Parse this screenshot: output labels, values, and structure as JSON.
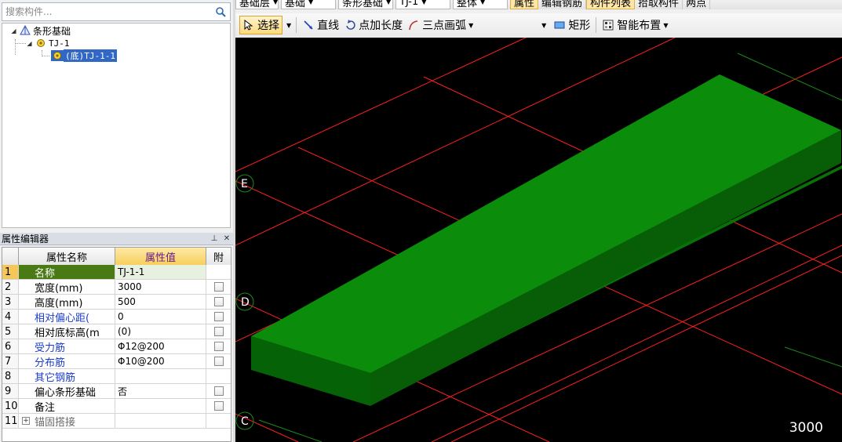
{
  "search": {
    "placeholder": "搜索构件..."
  },
  "tree": {
    "root": "条形基础",
    "group": "TJ-1",
    "leaf": "(底)TJ-1-1"
  },
  "property_editor": {
    "title": "属性编辑器",
    "headers": {
      "num": "",
      "name": "属性名称",
      "value": "属性值",
      "attach": "附"
    },
    "rows": [
      {
        "num": "1",
        "name": "名称",
        "value": "TJ-1-1",
        "checkbox": false,
        "selected": true
      },
      {
        "num": "2",
        "name": "宽度(mm)",
        "value": "3000",
        "checkbox": true
      },
      {
        "num": "3",
        "name": "高度(mm)",
        "value": "500",
        "checkbox": true
      },
      {
        "num": "4",
        "name": "相对偏心距(",
        "value": "0",
        "checkbox": true,
        "blue": true
      },
      {
        "num": "5",
        "name": "相对底标高(m",
        "value": "(0)",
        "checkbox": true
      },
      {
        "num": "6",
        "name": "受力筋",
        "value": "Φ12@200",
        "checkbox": true,
        "blue": true
      },
      {
        "num": "7",
        "name": "分布筋",
        "value": "Φ10@200",
        "checkbox": true,
        "blue": true
      },
      {
        "num": "8",
        "name": "其它钢筋",
        "value": "",
        "checkbox": false,
        "blue": true
      },
      {
        "num": "9",
        "name": "偏心条形基础",
        "value": "否",
        "checkbox": true
      },
      {
        "num": "10",
        "name": "备注",
        "value": "",
        "checkbox": true
      },
      {
        "num": "11",
        "name": "锚固搭接",
        "value": "",
        "checkbox": false,
        "expandable": true
      }
    ]
  },
  "toolbar1": {
    "floor_combo": "基础层",
    "category_combo": "基础",
    "type_combo": "条形基础",
    "component_combo": "TJ-1",
    "part_combo": "整体",
    "properties_btn": "属性",
    "edit_rebar_btn": "编辑钢筋",
    "component_list_btn": "构件列表",
    "pick_btn": "拾取构件",
    "axis_btn": "两点"
  },
  "toolbar2": {
    "select": "选择",
    "line": "直线",
    "point_length": "点加长度",
    "arc3": "三点画弧",
    "rect": "矩形",
    "smart": "智能布置"
  },
  "viewport": {
    "axis_labels": [
      "E",
      "D",
      "C"
    ],
    "dimension_readout": "3000",
    "colors": {
      "background": "#000000",
      "grid": "#ff2020",
      "element_top": "#0a8a0a",
      "element_front": "#087208",
      "element_side": "#065c06"
    }
  }
}
